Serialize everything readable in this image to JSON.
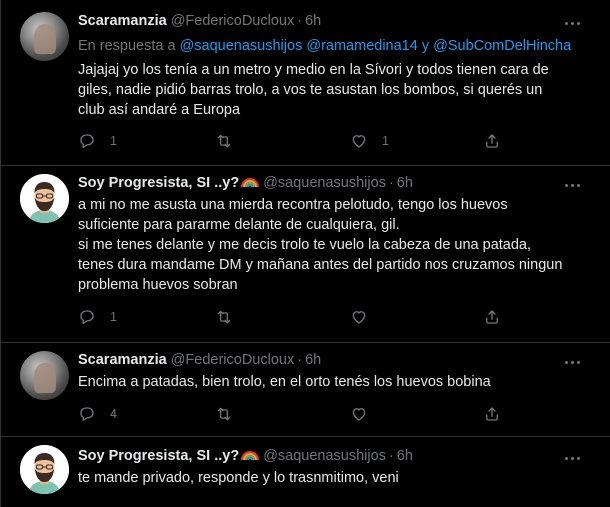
{
  "tweets": [
    {
      "display_name": "Scaramanzia",
      "handle": "@FedericoDucloux",
      "separator": "·",
      "time": "6h",
      "reply_prefix": "En respuesta a",
      "reply_mentions": [
        "@saquenasushijos",
        "@ramamedina14"
      ],
      "reply_conjunction": "y",
      "reply_last": "@SubComDelHincha",
      "lines": [
        "Jajajaj yo los tenía a un metro y medio en la Sívori  y todos tienen cara de",
        "giles, nadie pidió barras trolo, a vos te asustan los bombos, si querés un",
        "club así andaré a Europa"
      ],
      "reply_count": "1",
      "retweet_count": "",
      "like_count": "1"
    },
    {
      "display_name": "Soy Progresista, SI ..y?",
      "handle": "@saquenasushijos",
      "separator": "·",
      "time": "6h",
      "lines": [
        "a mi no me asusta una mierda recontra pelotudo, tengo los huevos",
        "suficiente para pararme delante de cualquiera, gil.",
        "si me tenes delante y me decis trolo te vuelo la cabeza de una patada,",
        "tenes dura mandame DM y mañana antes del partido nos cruzamos ningun",
        "problema huevos sobran"
      ],
      "reply_count": "1",
      "retweet_count": "",
      "like_count": ""
    },
    {
      "display_name": "Scaramanzia",
      "handle": "@FedericoDucloux",
      "separator": "·",
      "time": "6h",
      "lines": [
        "Encima a patadas, bien trolo, en el orto tenés los huevos bobina"
      ],
      "reply_count": "4",
      "retweet_count": "",
      "like_count": ""
    },
    {
      "display_name": "Soy Progresista, SI ..y?",
      "handle": "@saquenasushijos",
      "separator": "·",
      "time": "6h",
      "lines": [
        "te mande privado, responde y lo trasnmitimo, veni"
      ]
    }
  ],
  "colors": {
    "background": "#000000",
    "text": "#e7e9ea",
    "muted": "#71767b",
    "accent": "#1d9bf0",
    "divider": "#2f3336"
  },
  "icons": {
    "reply": "reply-icon",
    "retweet": "retweet-icon",
    "like": "heart-icon",
    "share": "share-icon",
    "more": "more-icon",
    "rainbow": "rainbow-emoji-icon"
  }
}
